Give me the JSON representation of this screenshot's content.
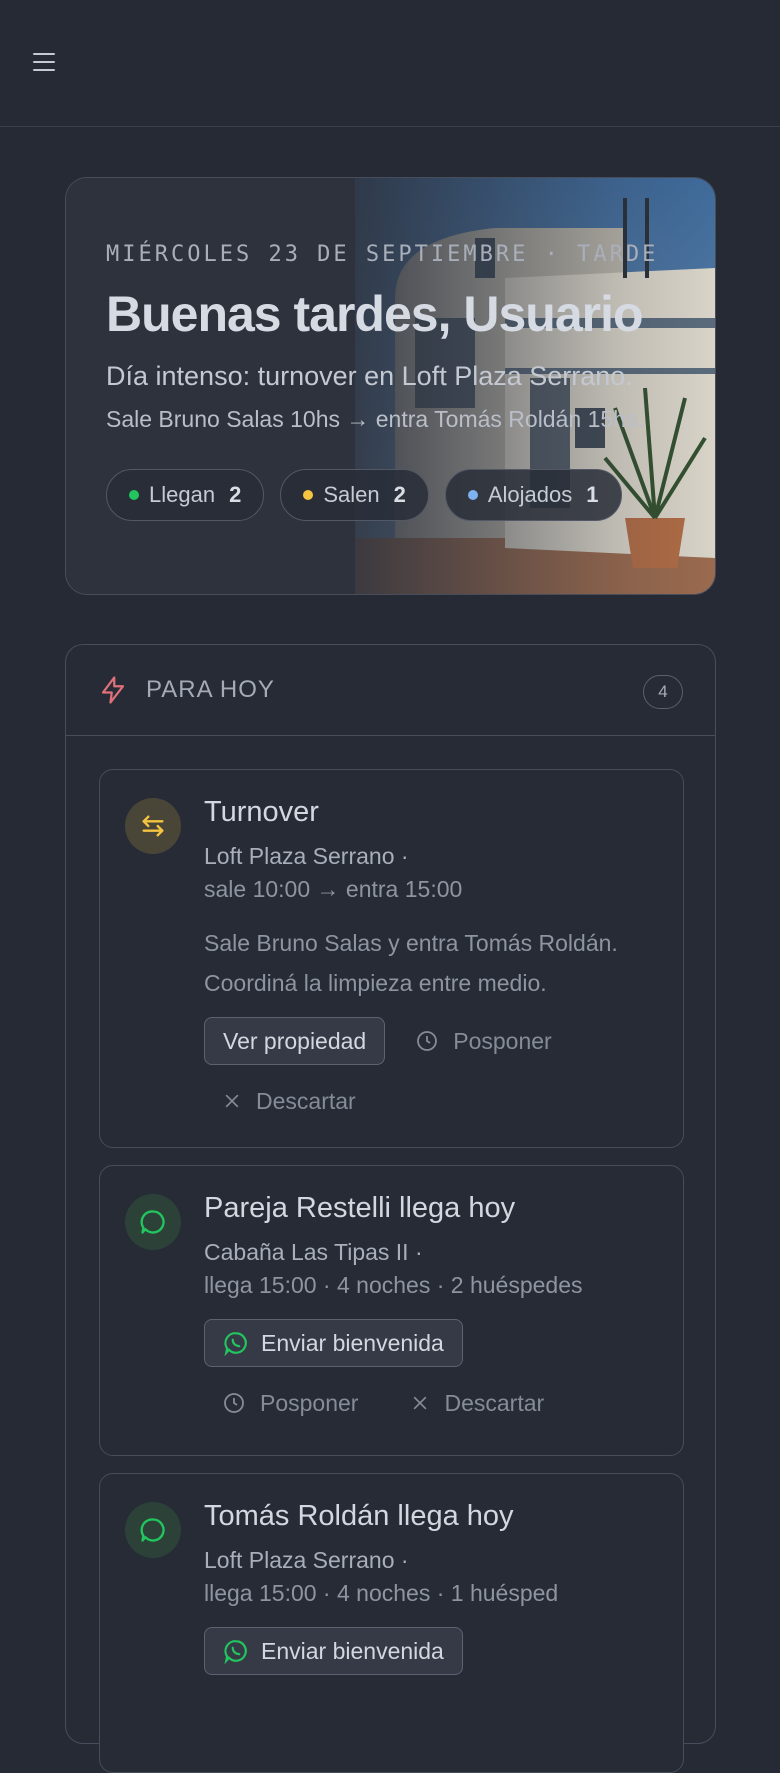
{
  "header": {
    "menu_icon": "hamburger-icon"
  },
  "hero": {
    "date": "MIÉRCOLES 23 DE SEPTIEMBRE · TARDE",
    "title": "Buenas tardes, Usuario",
    "subtitle": "Día intenso: turnover en Loft Plaza Serrano.",
    "detail": "Sale Bruno Salas 10hs → entra Tomás Roldán 15hs.",
    "chips": [
      {
        "label": "Llegan",
        "count": "2",
        "color": "#22c55e"
      },
      {
        "label": "Salen",
        "count": "2",
        "color": "#f5c542"
      },
      {
        "label": "Alojados",
        "count": "1",
        "color": "#7fb2f0"
      }
    ]
  },
  "today": {
    "title": "PARA HOY",
    "count": "4",
    "icon": "bolt-icon",
    "tasks": [
      {
        "title": "Turnover",
        "property": "Loft Plaza Serrano ·",
        "schedule": "sale 10:00 → entra 15:00",
        "description": "Sale Bruno Salas y entra Tomás Roldán. Coordiná la limpieza entre medio.",
        "primary": "Ver propiedad",
        "postpone": "Posponer",
        "dismiss": "Descartar",
        "icon": "swap-arrows-icon"
      },
      {
        "title": "Pareja Restelli llega hoy",
        "property": "Cabaña Las Tipas II ·",
        "schedule": "llega 15:00 · 4 noches · 2 huéspedes",
        "primary": "Enviar bienvenida",
        "postpone": "Posponer",
        "dismiss": "Descartar",
        "icon": "chat-icon"
      },
      {
        "title": "Tomás Roldán llega hoy",
        "property": "Loft Plaza Serrano ·",
        "schedule": "llega 15:00 · 4 noches · 1 huésped",
        "primary": "Enviar bienvenida",
        "icon": "chat-icon"
      }
    ]
  }
}
